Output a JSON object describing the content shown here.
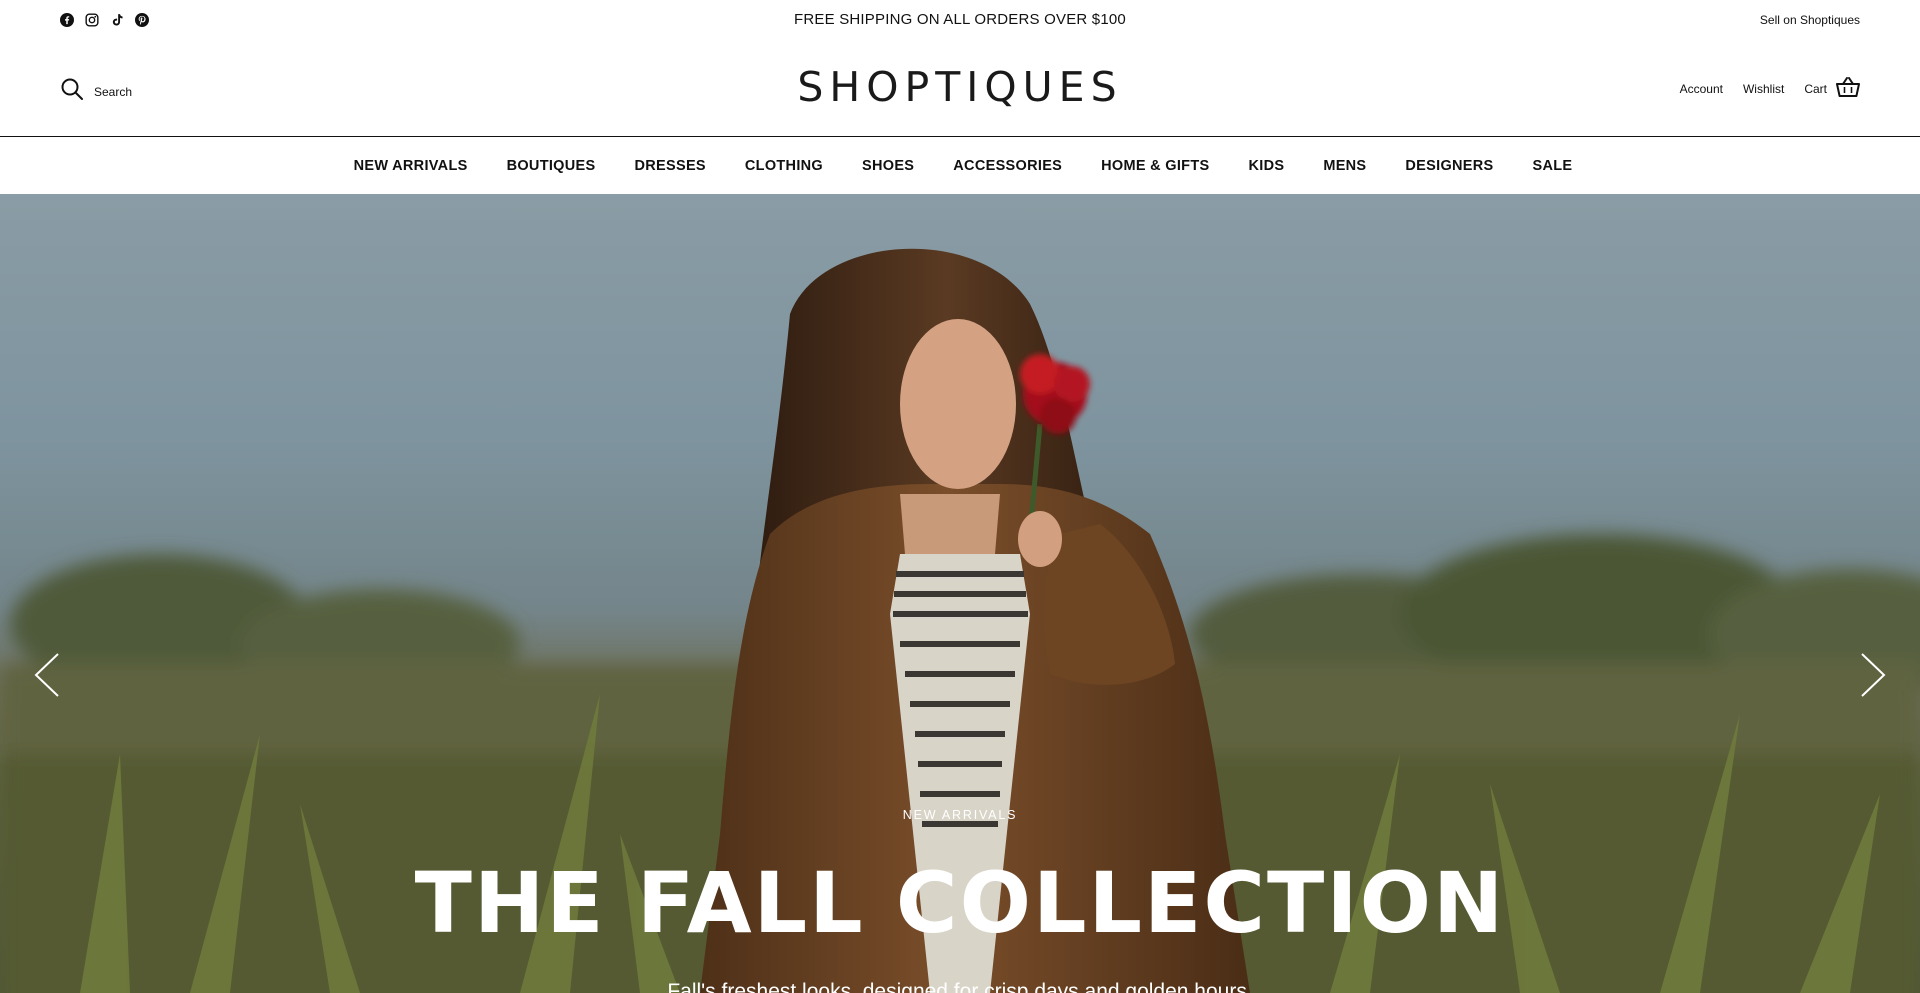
{
  "topbar": {
    "social": [
      {
        "icon": "facebook-icon"
      },
      {
        "icon": "instagram-icon"
      },
      {
        "icon": "tiktok-icon"
      },
      {
        "icon": "pinterest-icon"
      }
    ],
    "announcement": "FREE SHIPPING ON ALL ORDERS OVER $100",
    "sell_link": "Sell on Shoptiques"
  },
  "header": {
    "search_label": "Search",
    "logo": "SHOPTIQUES",
    "account": "Account",
    "wishlist": "Wishlist",
    "cart": "Cart"
  },
  "nav": {
    "items": [
      {
        "label": "NEW ARRIVALS"
      },
      {
        "label": "BOUTIQUES"
      },
      {
        "label": "DRESSES"
      },
      {
        "label": "CLOTHING"
      },
      {
        "label": "SHOES"
      },
      {
        "label": "ACCESSORIES"
      },
      {
        "label": "HOME & GIFTS"
      },
      {
        "label": "KIDS"
      },
      {
        "label": "MENS"
      },
      {
        "label": "DESIGNERS"
      },
      {
        "label": "SALE"
      }
    ]
  },
  "hero": {
    "kicker": "NEW ARRIVALS",
    "headline": "THE FALL COLLECTION",
    "subline": "Fall's freshest looks, designed for crisp days and golden hours."
  },
  "colors": {
    "text": "#111111",
    "hero_sky": "#8a9ca5",
    "coat": "#6b4424",
    "flower": "#b3141b"
  }
}
